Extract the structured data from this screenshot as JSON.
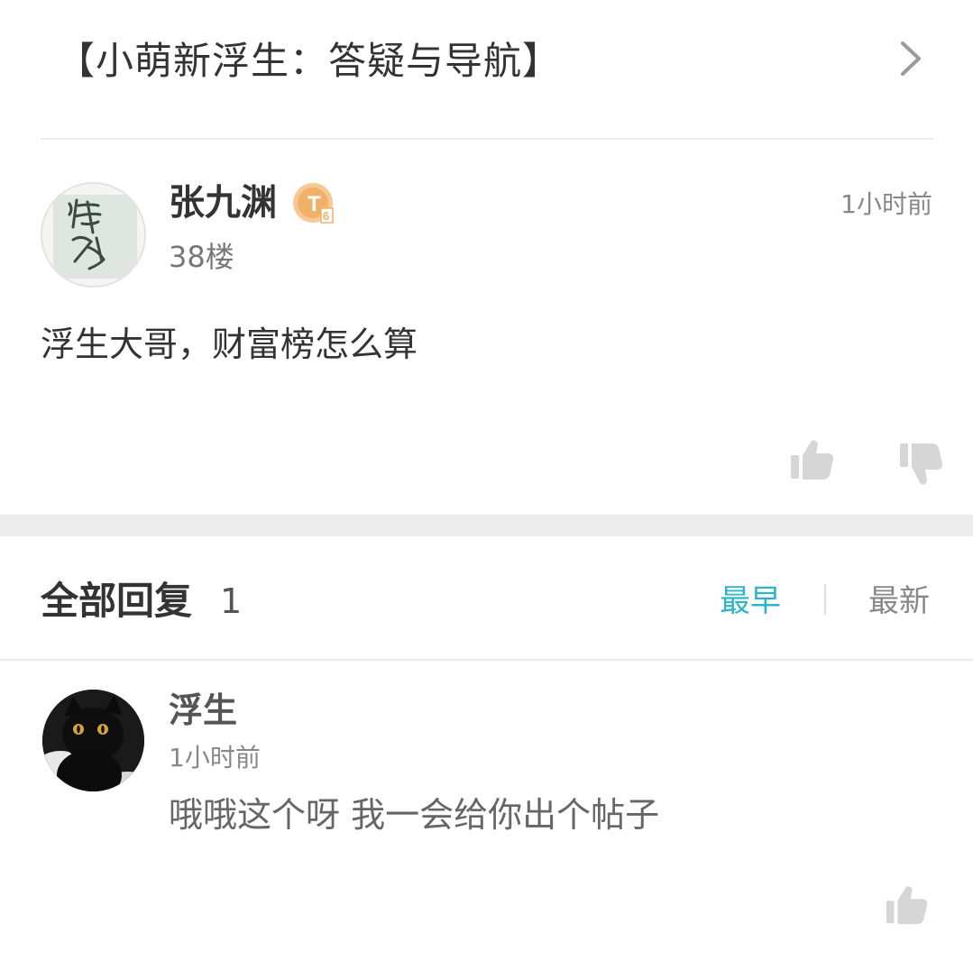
{
  "thread": {
    "title": "【小萌新浮生：答疑与导航】",
    "chevron_icon": "chevron-right-icon"
  },
  "post": {
    "username": "张九渊",
    "level_badge": "T6",
    "floor": "38楼",
    "time": "1小时前",
    "content": "浮生大哥，财富榜怎么算",
    "avatar_icon": "calligraphy-avatar",
    "like_icon": "thumbs-up-icon",
    "dislike_icon": "thumbs-down-icon",
    "badge_color": "#f0b168"
  },
  "replies": {
    "title": "全部回复",
    "count": "1",
    "sort_earliest": "最早",
    "sort_latest": "最新",
    "active_color": "#2bb5c8"
  },
  "reply": {
    "username": "浮生",
    "time": "1小时前",
    "content": "哦哦这个呀 我一会给你出个帖子",
    "avatar_icon": "black-cat-avatar",
    "like_icon": "thumbs-up-icon"
  }
}
